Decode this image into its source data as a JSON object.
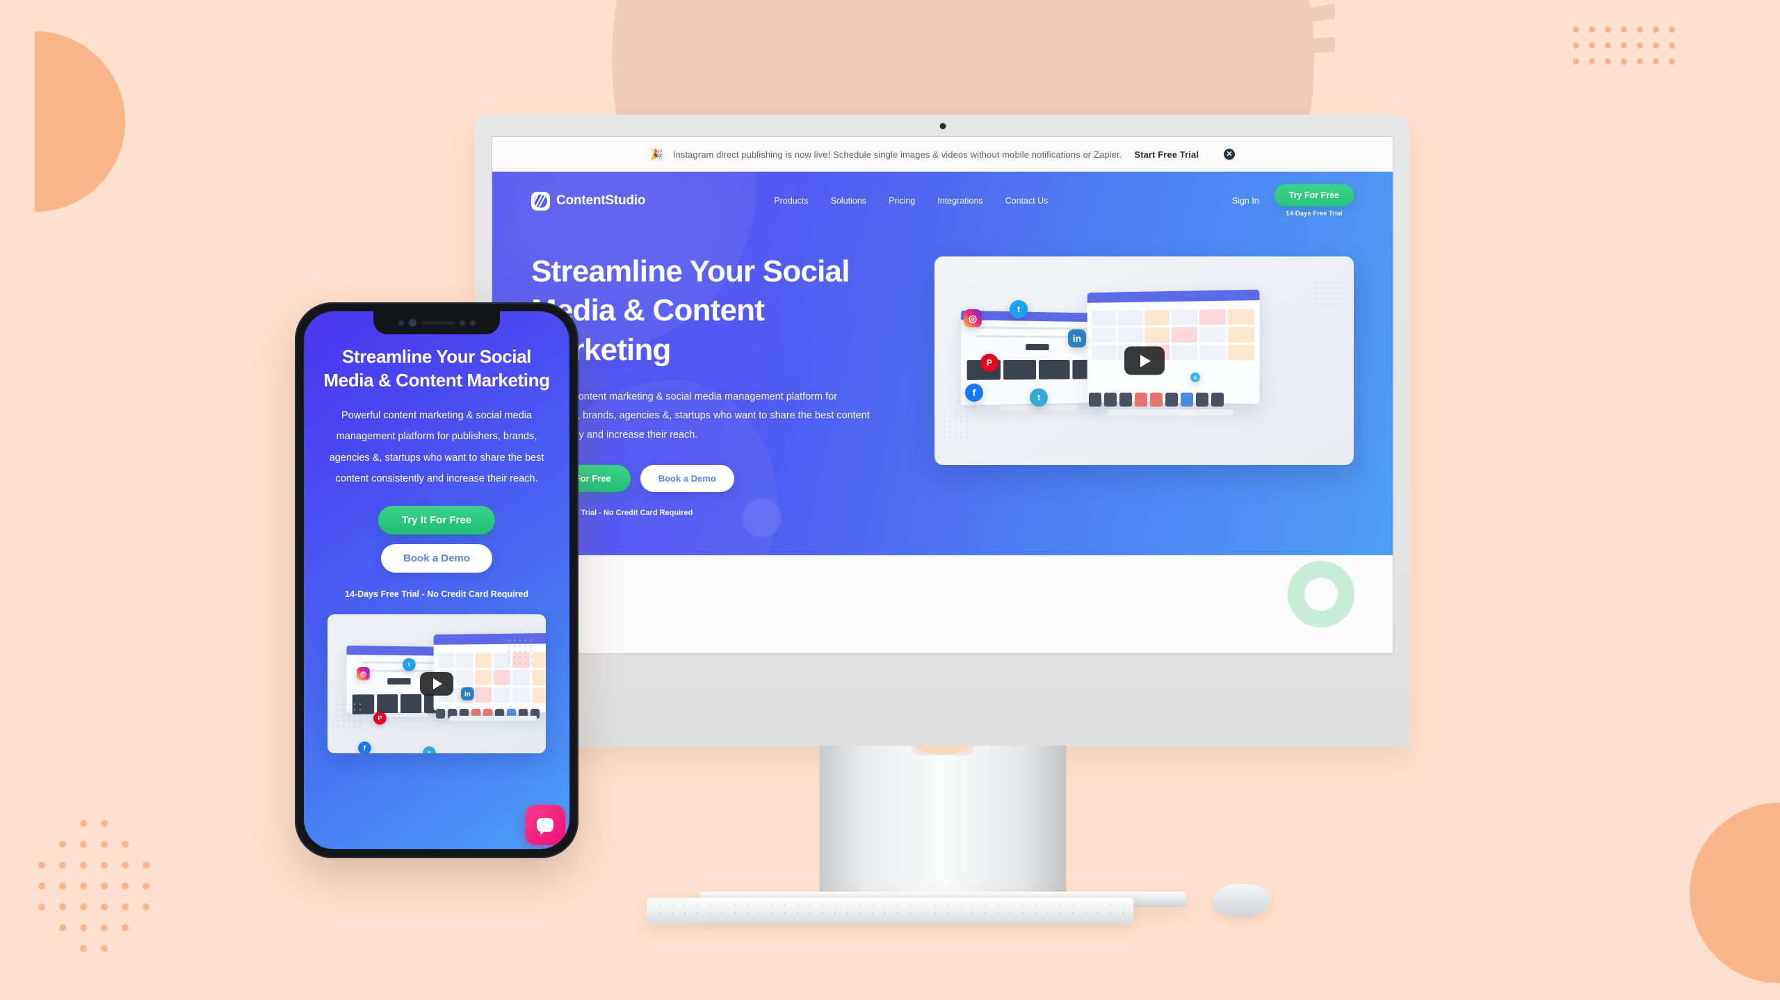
{
  "background": {
    "base_color": "#fde0cd",
    "accent_color": "#fbb58a",
    "circle_color": "#edccb9"
  },
  "desktop": {
    "announcement": {
      "emoji": "🎉",
      "text": "Instagram direct publishing is now live! Schedule single images & videos without mobile notifications or Zapier.",
      "cta": "Start Free Trial",
      "close": "✕"
    },
    "nav": {
      "brand": "ContentStudio",
      "links": [
        "Products",
        "Solutions",
        "Pricing",
        "Integrations",
        "Contact Us"
      ],
      "signin": "Sign In",
      "try_button": "Try For Free",
      "try_note": "14-Days Free Trial"
    },
    "hero": {
      "heading": "Streamline Your Social Media & Content Marketing",
      "paragraph": "Powerful content marketing & social media management platform for publishers, brands, agencies &, startups who want to share the best content consistently and increase their reach.",
      "primary_button": "Try It For Free",
      "secondary_button": "Book a Demo",
      "note": "14-Days Free Trial - No Credit Card Required",
      "gradient_from": "#4b4ff0",
      "gradient_to": "#4e9df5"
    },
    "video": {
      "play_label": "▶",
      "social_icons": [
        "instagram-icon",
        "twitter-icon",
        "linkedin-icon",
        "pinterest-icon",
        "facebook-icon",
        "tumblr-icon"
      ],
      "social_glyphs": {
        "instagram": "◎",
        "twitter": "t",
        "linkedin": "in",
        "pinterest": "P",
        "facebook": "f",
        "tumblr": "t",
        "small": "s"
      }
    },
    "decor": {
      "ring_green": "#c9ecd8",
      "ring_blue": "#d8ecfa"
    }
  },
  "phone": {
    "heading": "Streamline Your Social Media & Content Marketing",
    "paragraph": "Powerful content marketing & social media management platform for publishers, brands, agencies &, startups who want to share the best content consistently and increase their reach.",
    "primary_button": "Try It For Free",
    "secondary_button": "Book a Demo",
    "note": "14-Days Free Trial - No Credit Card Required",
    "chat_widget_color": "#ec0f77"
  }
}
